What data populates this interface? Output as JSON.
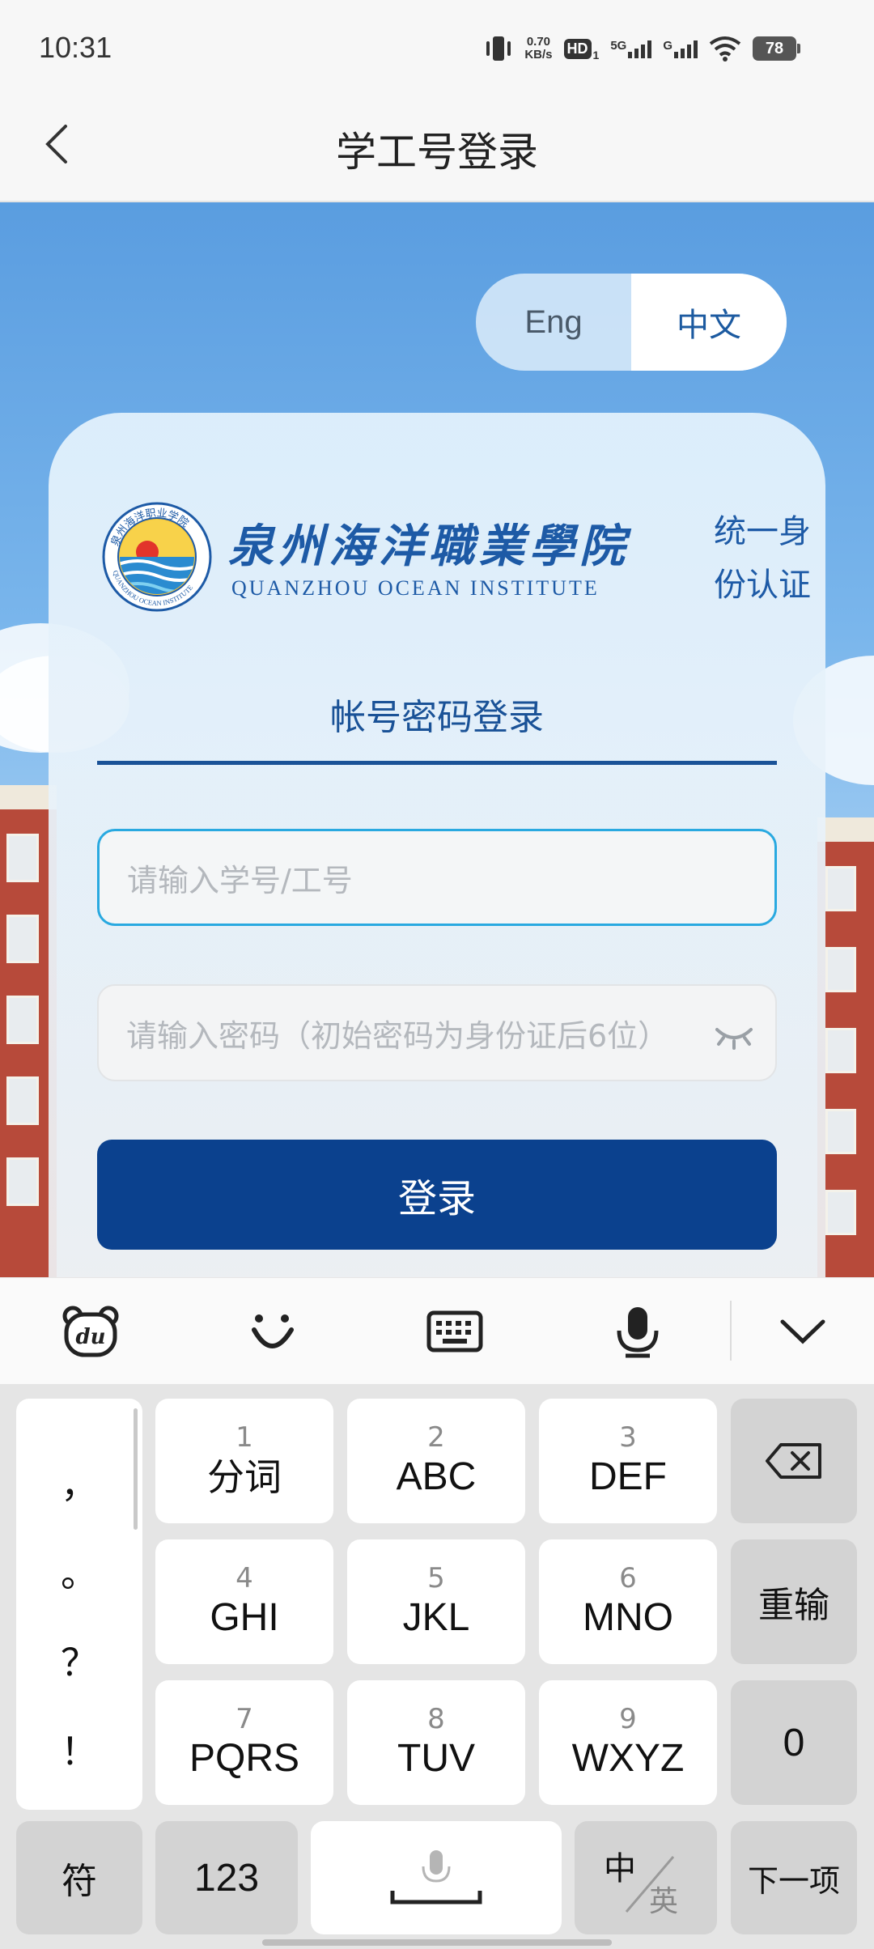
{
  "status_bar": {
    "time": "10:31",
    "net_speed_value": "0.70",
    "net_speed_unit": "KB/s",
    "hd_label": "HD",
    "hd_sub": "1",
    "sig1_label": "5G",
    "sig2_label": "G",
    "battery": "78"
  },
  "header": {
    "title": "学工号登录",
    "back_icon": "chevron-left-icon"
  },
  "language_toggle": {
    "options": [
      "Eng",
      "中文"
    ],
    "selected": "中文"
  },
  "brand": {
    "school_name_cn": "泉州海洋職業學院",
    "school_name_en": "QUANZHOU OCEAN INSTITUTE",
    "auth_label_line1": "统一身",
    "auth_label_line2": "份认证",
    "seal_top_text": "泉州海洋职业学院",
    "seal_bottom_text": "QUANZHOU OCEAN INSTITUTE"
  },
  "login_form": {
    "tab_label": "帐号密码登录",
    "username_placeholder": "请输入学号/工号",
    "password_placeholder": "请输入密码（初始密码为身份证后6位）",
    "password_visibility_icon": "eye-closed-icon",
    "submit_label": "登录"
  },
  "keyboard": {
    "toolbar_icons": [
      "du-bear-icon",
      "emoji-icon",
      "keyboard-icon",
      "microphone-icon",
      "chevron-down-icon"
    ],
    "punctuation": [
      "，",
      "。",
      "？",
      "！"
    ],
    "keys": [
      {
        "num": "1",
        "label": "分词"
      },
      {
        "num": "2",
        "label": "ABC"
      },
      {
        "num": "3",
        "label": "DEF"
      },
      {
        "num": "4",
        "label": "GHI"
      },
      {
        "num": "5",
        "label": "JKL"
      },
      {
        "num": "6",
        "label": "MNO"
      },
      {
        "num": "7",
        "label": "PQRS"
      },
      {
        "num": "8",
        "label": "TUV"
      },
      {
        "num": "9",
        "label": "WXYZ"
      }
    ],
    "backspace_icon": "backspace-icon",
    "reenter_label": "重输",
    "zero_label": "0",
    "symbol_label": "符",
    "num_label": "123",
    "space_icon": "space-mic-icon",
    "lang_switch_main": "中",
    "lang_switch_sub": "英",
    "next_label": "下一项"
  },
  "colors": {
    "primary": "#0b418e",
    "accent_border": "#29a9e0",
    "brand_blue": "#1d5aa6"
  }
}
